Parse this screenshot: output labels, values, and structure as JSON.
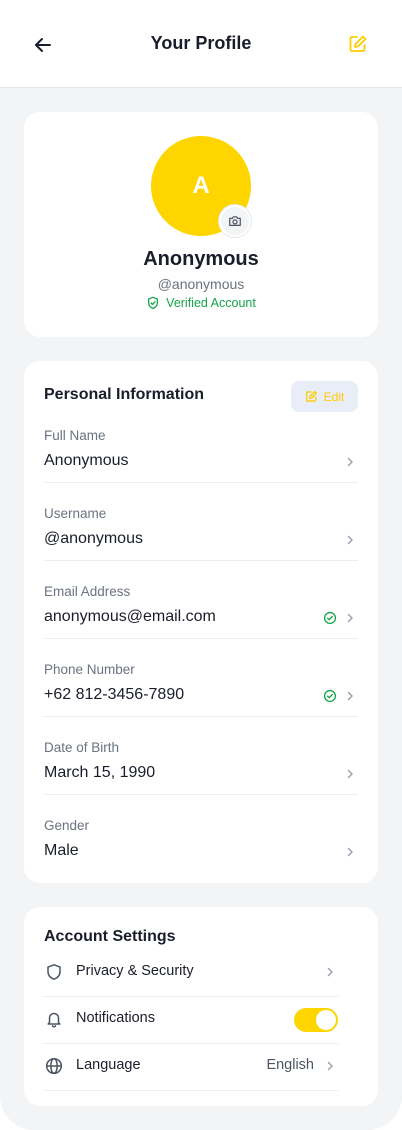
{
  "header": {
    "title": "Your Profile"
  },
  "profile": {
    "initial": "A",
    "name": "Anonymous",
    "handle": "@anonymous",
    "verified_label": "Verified Account"
  },
  "personal": {
    "title": "Personal Information",
    "edit_label": "Edit",
    "fields": [
      {
        "label": "Full Name",
        "value": "Anonymous",
        "verified": false
      },
      {
        "label": "Username",
        "value": "@anonymous",
        "verified": false
      },
      {
        "label": "Email Address",
        "value": "anonymous@email.com",
        "verified": true
      },
      {
        "label": "Phone Number",
        "value": "+62 812-3456-7890",
        "verified": true
      },
      {
        "label": "Date of Birth",
        "value": "March 15, 1990",
        "verified": false
      },
      {
        "label": "Gender",
        "value": "Male",
        "verified": false
      }
    ]
  },
  "settings": {
    "title": "Account Settings",
    "items": [
      {
        "label": "Privacy & Security",
        "icon": "shield-icon"
      },
      {
        "label": "Notifications",
        "icon": "bell-icon",
        "toggle_on": true
      },
      {
        "label": "Language",
        "icon": "globe-icon",
        "value": "English"
      }
    ]
  },
  "colors": {
    "accent": "#ffd500",
    "verified": "#16a34a",
    "background": "#f3f4f6"
  }
}
